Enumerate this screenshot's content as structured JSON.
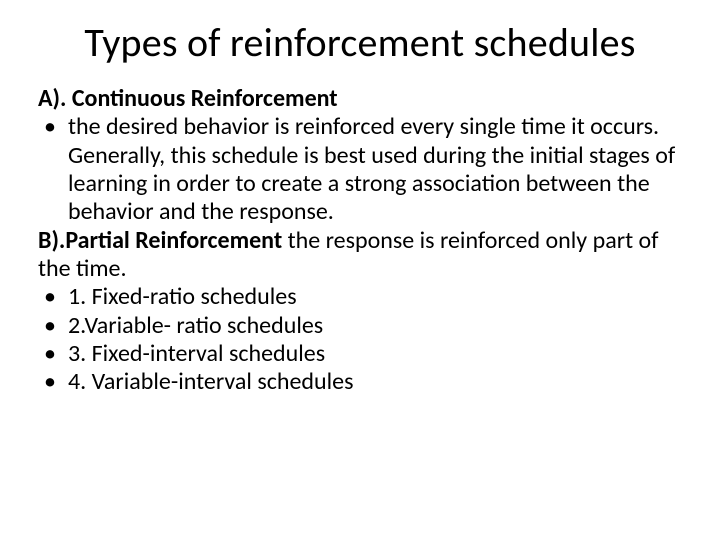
{
  "title": "Types of reinforcement schedules",
  "sectionA": {
    "heading": "A). Continuous Reinforcement",
    "bullet": "the desired behavior is reinforced every single time it occurs. Generally, this schedule is best used during the initial stages of learning in order to create a strong association between the behavior and the response."
  },
  "sectionB": {
    "heading": "B).Partial Reinforcement",
    "intro": " the response is reinforced only part of the time.",
    "items": [
      "1. Fixed-ratio schedules",
      "2.Variable- ratio schedules",
      "3. Fixed-interval schedules",
      "4. Variable-interval schedules"
    ]
  },
  "bulletChar": "•"
}
